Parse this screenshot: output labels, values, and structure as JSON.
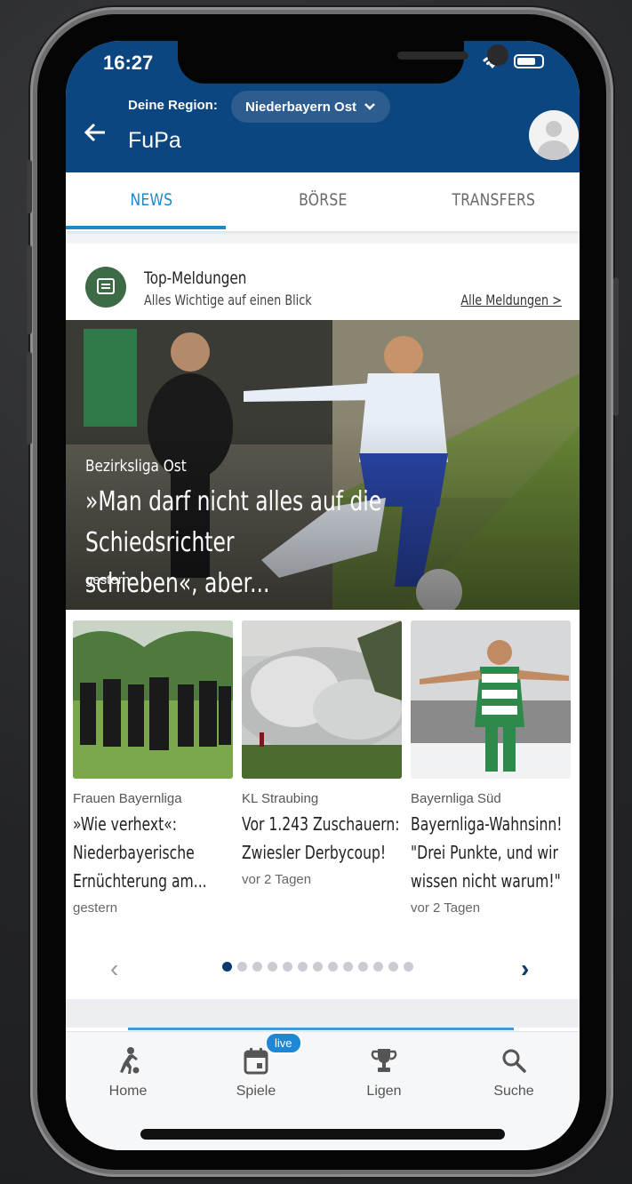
{
  "status_bar": {
    "time": "16:27"
  },
  "header": {
    "region_label": "Deine Region:",
    "region_value": "Niederbayern Ost",
    "app_title": "FuPa"
  },
  "tabs": [
    {
      "label": "NEWS",
      "active": true
    },
    {
      "label": "BÖRSE",
      "active": false
    },
    {
      "label": "TRANSFERS",
      "active": false
    }
  ],
  "top_section": {
    "title": "Top-Meldungen",
    "subtitle": "Alles Wichtige auf einen Blick",
    "all_link": "Alle Meldungen >"
  },
  "hero": {
    "category": "Bezirksliga Ost",
    "title_line1": "»Man darf nicht alles auf die Schiedsrichter",
    "title_line2": "schieben«, aber...",
    "date": "gestern"
  },
  "articles": [
    {
      "category": "Frauen Bayernliga",
      "title_l1": "»Wie verhext«:",
      "title_l2": "Niederbayerische",
      "title_l3": "Ernüchterung am...",
      "date": "gestern"
    },
    {
      "category": "KL Straubing",
      "title_l1": "Vor 1.243 Zuschauern:",
      "title_l2": "Zwiesler Derbycoup!",
      "title_l3": "",
      "date": "vor 2 Tagen"
    },
    {
      "category": "Bayernliga Süd",
      "title_l1": "Bayernliga-Wahnsinn!",
      "title_l2": "\"Drei Punkte, und wir",
      "title_l3": "wissen nicht warum!\"",
      "date": "vor 2 Tagen"
    }
  ],
  "pager": {
    "prev": "‹",
    "next": "›",
    "total": 13,
    "current": 1
  },
  "bottom_nav": [
    {
      "label": "Home",
      "icon": "soccer-player-icon"
    },
    {
      "label": "Spiele",
      "icon": "calendar-icon",
      "badge": "live"
    },
    {
      "label": "Ligen",
      "icon": "trophy-icon"
    },
    {
      "label": "Suche",
      "icon": "search-icon"
    }
  ],
  "colors": {
    "header_bg": "#0b4680",
    "accent": "#1e88c9",
    "dot_active": "#0b3a6b"
  }
}
